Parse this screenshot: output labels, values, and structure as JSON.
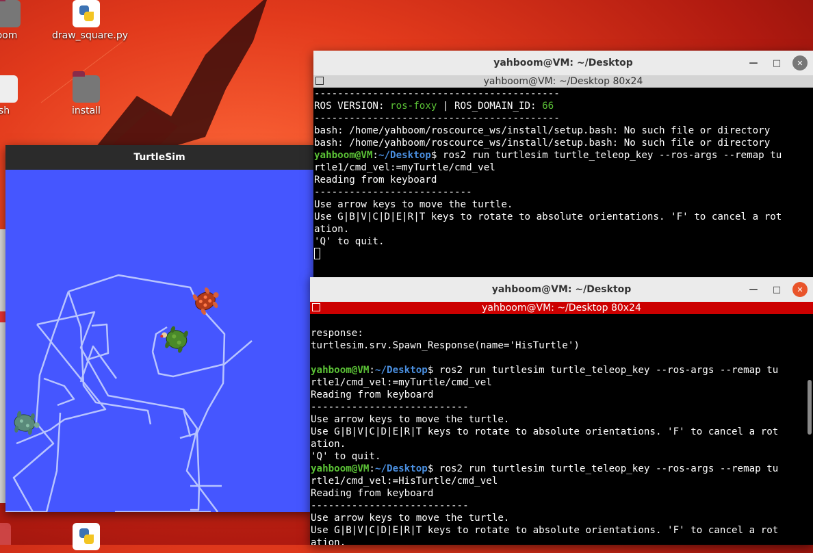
{
  "desktop": {
    "icons": [
      {
        "label": "oom",
        "type": "folder"
      },
      {
        "label": "draw_square.py",
        "type": "python"
      },
      {
        "label": "sh",
        "type": "script"
      },
      {
        "label": "install",
        "type": "folder"
      }
    ]
  },
  "turtlesim": {
    "title": "TurtleSim",
    "background": "#4556ff"
  },
  "terminal1": {
    "title": "yahboom@VM: ~/Desktop",
    "subtitle": "yahboom@VM: ~/Desktop 80x24",
    "lines": [
      {
        "segments": [
          {
            "t": "------------------------------------------"
          }
        ]
      },
      {
        "segments": [
          {
            "t": "ROS VERSION: "
          },
          {
            "t": "ros-foxy",
            "c": "green"
          },
          {
            "t": " | ROS_DOMAIN_ID: "
          },
          {
            "t": "66",
            "c": "green"
          }
        ]
      },
      {
        "segments": [
          {
            "t": "------------------------------------------"
          }
        ]
      },
      {
        "segments": [
          {
            "t": "bash: /home/yahboom/roscource_ws/install/setup.bash: No such file or directory"
          }
        ]
      },
      {
        "segments": [
          {
            "t": "bash: /home/yahboom/roscource_ws/install/setup.bash: No such file or directory"
          }
        ]
      },
      {
        "segments": [
          {
            "t": "yahboom@VM",
            "c": "green bold"
          },
          {
            "t": ":"
          },
          {
            "t": "~/Desktop",
            "c": "blue bold"
          },
          {
            "t": "$ ros2 run turtlesim turtle_teleop_key --ros-args --remap tu"
          }
        ]
      },
      {
        "segments": [
          {
            "t": "rtle1/cmd_vel:=myTurtle/cmd_vel"
          }
        ]
      },
      {
        "segments": [
          {
            "t": "Reading from keyboard"
          }
        ]
      },
      {
        "segments": [
          {
            "t": "---------------------------"
          }
        ]
      },
      {
        "segments": [
          {
            "t": "Use arrow keys to move the turtle."
          }
        ]
      },
      {
        "segments": [
          {
            "t": "Use G|B|V|C|D|E|R|T keys to rotate to absolute orientations. 'F' to cancel a rot"
          }
        ]
      },
      {
        "segments": [
          {
            "t": "ation."
          }
        ]
      },
      {
        "segments": [
          {
            "t": "'Q' to quit."
          }
        ]
      }
    ]
  },
  "terminal2": {
    "title": "yahboom@VM: ~/Desktop",
    "subtitle": "yahboom@VM: ~/Desktop 80x24",
    "lines": [
      {
        "segments": [
          {
            "t": "response:"
          }
        ]
      },
      {
        "segments": [
          {
            "t": "turtlesim.srv.Spawn_Response(name='HisTurtle')"
          }
        ]
      },
      {
        "segments": [
          {
            "t": ""
          }
        ]
      },
      {
        "segments": [
          {
            "t": "yahboom@VM",
            "c": "green bold"
          },
          {
            "t": ":"
          },
          {
            "t": "~/Desktop",
            "c": "blue bold"
          },
          {
            "t": "$ ros2 run turtlesim turtle_teleop_key --ros-args --remap tu"
          }
        ]
      },
      {
        "segments": [
          {
            "t": "rtle1/cmd_vel:=myTurtle/cmd_vel"
          }
        ]
      },
      {
        "segments": [
          {
            "t": "Reading from keyboard"
          }
        ]
      },
      {
        "segments": [
          {
            "t": "---------------------------"
          }
        ]
      },
      {
        "segments": [
          {
            "t": "Use arrow keys to move the turtle."
          }
        ]
      },
      {
        "segments": [
          {
            "t": "Use G|B|V|C|D|E|R|T keys to rotate to absolute orientations. 'F' to cancel a rot"
          }
        ]
      },
      {
        "segments": [
          {
            "t": "ation."
          }
        ]
      },
      {
        "segments": [
          {
            "t": "'Q' to quit."
          }
        ]
      },
      {
        "segments": [
          {
            "t": "yahboom@VM",
            "c": "green bold"
          },
          {
            "t": ":"
          },
          {
            "t": "~/Desktop",
            "c": "blue bold"
          },
          {
            "t": "$ ros2 run turtlesim turtle_teleop_key --ros-args --remap tu"
          }
        ]
      },
      {
        "segments": [
          {
            "t": "rtle1/cmd_vel:=HisTurtle/cmd_vel"
          }
        ]
      },
      {
        "segments": [
          {
            "t": "Reading from keyboard"
          }
        ]
      },
      {
        "segments": [
          {
            "t": "---------------------------"
          }
        ]
      },
      {
        "segments": [
          {
            "t": "Use arrow keys to move the turtle."
          }
        ]
      },
      {
        "segments": [
          {
            "t": "Use G|B|V|C|D|E|R|T keys to rotate to absolute orientations. 'F' to cancel a rot"
          }
        ]
      },
      {
        "segments": [
          {
            "t": "ation."
          }
        ]
      }
    ]
  },
  "colors": {
    "active_subbar": "#cc0000",
    "inactive_subbar": "#d4d4d4",
    "prompt_user": "#5bc236",
    "prompt_path": "#4a8fe0",
    "trail": "#b8c4ff"
  }
}
